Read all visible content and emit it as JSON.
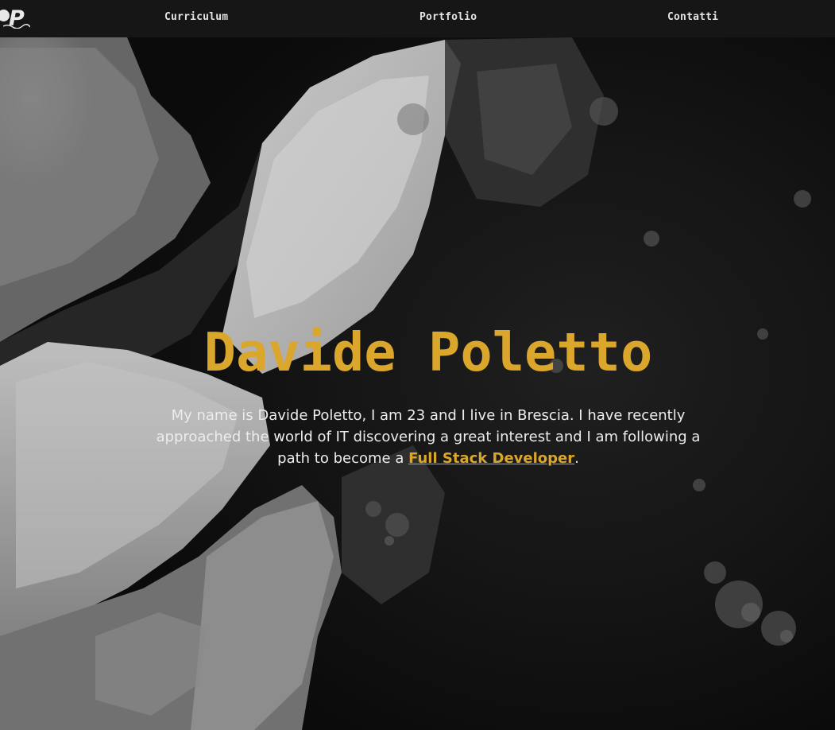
{
  "logo": {
    "letter": "P"
  },
  "nav": {
    "items": [
      {
        "label": "Curriculum"
      },
      {
        "label": "Portfolio"
      },
      {
        "label": "Contatti"
      }
    ]
  },
  "hero": {
    "title": "Davide Poletto",
    "intro_text": "My name is Davide Poletto, I am 23 and I live in Brescia. I have recently approached the world of IT discovering a great interest and I am following a path to become a ",
    "link_text": "Full Stack Developer",
    "intro_end": "."
  },
  "colors": {
    "accent": "#dba62c",
    "nav_background": "#181818",
    "text": "#ececec"
  }
}
